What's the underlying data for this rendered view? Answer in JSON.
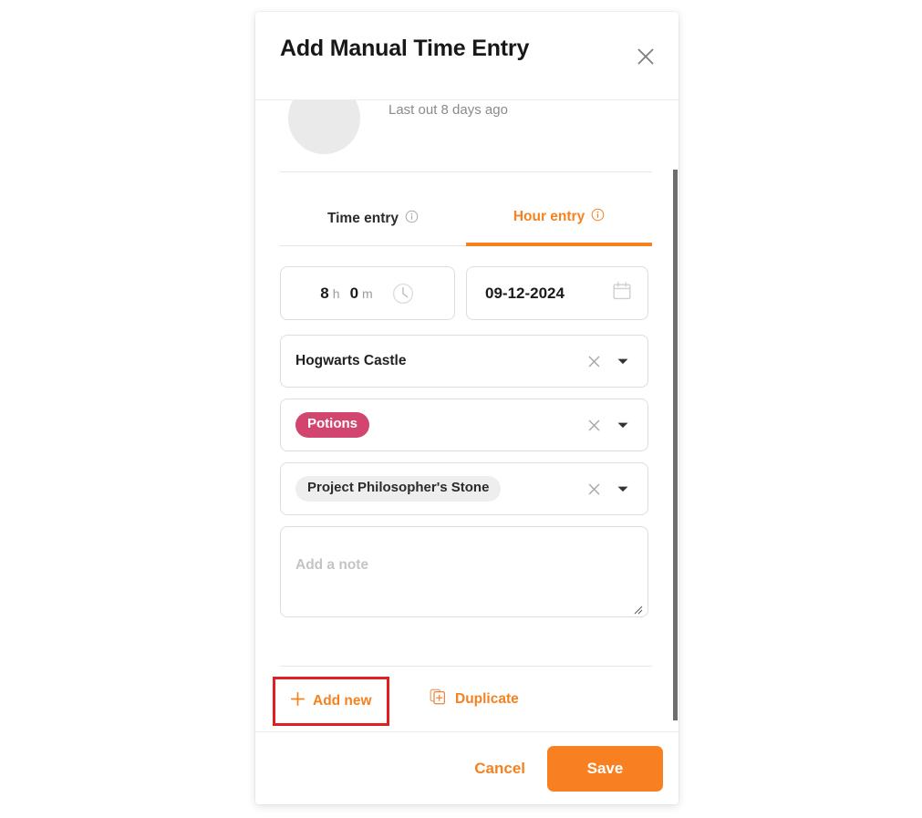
{
  "modal": {
    "title": "Add Manual Time Entry",
    "close_icon": "close-icon"
  },
  "profile": {
    "avatar_icon": "avatar-placeholder",
    "last_out": "Last out 8 days ago"
  },
  "tabs": [
    {
      "label": "Time entry",
      "active": false,
      "info_icon": "info-icon"
    },
    {
      "label": "Hour entry",
      "active": true,
      "info_icon": "info-icon"
    }
  ],
  "duration": {
    "hours": "8",
    "hours_unit": "h",
    "minutes": "0",
    "minutes_unit": "m",
    "icon": "clock-icon"
  },
  "date": {
    "value": "09-12-2024",
    "icon": "calendar-icon"
  },
  "selects": [
    {
      "name": "customer",
      "value": "Hogwarts Castle",
      "style": "plain",
      "clear_icon": "close-icon",
      "caret_icon": "chevron-down-icon"
    },
    {
      "name": "tag",
      "value": "Potions",
      "style": "chip-tag",
      "clear_icon": "close-icon",
      "caret_icon": "chevron-down-icon"
    },
    {
      "name": "project",
      "value": "Project Philosopher's Stone",
      "style": "chip-project",
      "clear_icon": "close-icon",
      "caret_icon": "chevron-down-icon"
    }
  ],
  "note": {
    "placeholder": "Add a note",
    "value": ""
  },
  "row_actions": {
    "add_new": {
      "label": "Add new",
      "icon": "plus-icon"
    },
    "duplicate": {
      "label": "Duplicate",
      "icon": "duplicate-icon"
    }
  },
  "footer": {
    "cancel_label": "Cancel",
    "save_label": "Save"
  },
  "colors": {
    "accent": "#f5821f",
    "save_button": "#f98020",
    "tag_chip": "#d2456e",
    "project_chip": "#eeeeee",
    "highlight_box": "#e02020",
    "muted_text": "#8a8a8a"
  }
}
